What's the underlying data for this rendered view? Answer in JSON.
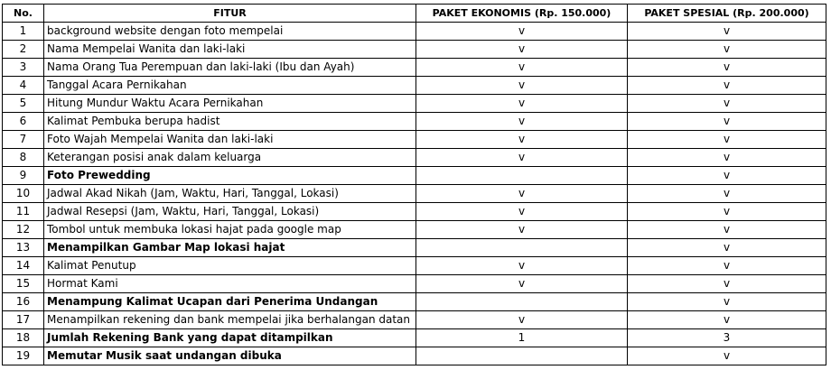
{
  "header": {
    "no": "No.",
    "fitur": "FITUR",
    "ekonomis": "PAKET EKONOMIS (Rp. 150.000)",
    "spesial": "PAKET SPESIAL (Rp. 200.000)"
  },
  "rows": [
    {
      "no": "1",
      "fitur": "background website dengan foto mempelai",
      "bold": false,
      "ekonomis": "v",
      "spesial": "v"
    },
    {
      "no": "2",
      "fitur": "Nama Mempelai Wanita dan laki-laki",
      "bold": false,
      "ekonomis": "v",
      "spesial": "v"
    },
    {
      "no": "3",
      "fitur": "Nama Orang Tua Perempuan dan laki-laki (Ibu dan Ayah)",
      "bold": false,
      "ekonomis": "v",
      "spesial": "v"
    },
    {
      "no": "4",
      "fitur": "Tanggal Acara Pernikahan",
      "bold": false,
      "ekonomis": "v",
      "spesial": "v"
    },
    {
      "no": "5",
      "fitur": "Hitung Mundur Waktu Acara Pernikahan",
      "bold": false,
      "ekonomis": "v",
      "spesial": "v"
    },
    {
      "no": "6",
      "fitur": "Kalimat Pembuka berupa hadist",
      "bold": false,
      "ekonomis": "v",
      "spesial": "v"
    },
    {
      "no": "7",
      "fitur": "Foto Wajah Mempelai Wanita dan laki-laki",
      "bold": false,
      "ekonomis": "v",
      "spesial": "v"
    },
    {
      "no": "8",
      "fitur": "Keterangan posisi anak dalam keluarga",
      "bold": false,
      "ekonomis": "v",
      "spesial": "v"
    },
    {
      "no": "9",
      "fitur": "Foto Prewedding",
      "bold": true,
      "ekonomis": "",
      "spesial": "v"
    },
    {
      "no": "10",
      "fitur": "Jadwal Akad Nikah (Jam, Waktu, Hari, Tanggal, Lokasi)",
      "bold": false,
      "ekonomis": "v",
      "spesial": "v"
    },
    {
      "no": "11",
      "fitur": "Jadwal Resepsi (Jam, Waktu, Hari, Tanggal, Lokasi)",
      "bold": false,
      "ekonomis": "v",
      "spesial": "v"
    },
    {
      "no": "12",
      "fitur": "Tombol untuk membuka lokasi hajat pada google map",
      "bold": false,
      "ekonomis": "v",
      "spesial": "v"
    },
    {
      "no": "13",
      "fitur": "Menampilkan Gambar Map lokasi hajat",
      "bold": true,
      "ekonomis": "",
      "spesial": "v"
    },
    {
      "no": "14",
      "fitur": "Kalimat Penutup",
      "bold": false,
      "ekonomis": "v",
      "spesial": "v"
    },
    {
      "no": "15",
      "fitur": "Hormat Kami",
      "bold": false,
      "ekonomis": "v",
      "spesial": "v"
    },
    {
      "no": "16",
      "fitur": "Menampung Kalimat Ucapan dari Penerima Undangan",
      "bold": true,
      "ekonomis": "",
      "spesial": "v"
    },
    {
      "no": "17",
      "fitur": "Menampilkan rekening dan bank mempelai jika berhalangan datan",
      "bold": false,
      "ekonomis": "v",
      "spesial": "v"
    },
    {
      "no": "18",
      "fitur": "Jumlah Rekening Bank yang dapat ditampilkan",
      "bold": true,
      "ekonomis": "1",
      "spesial": "3"
    },
    {
      "no": "19",
      "fitur": "Memutar Musik saat undangan dibuka",
      "bold": true,
      "ekonomis": "",
      "spesial": "v"
    }
  ]
}
